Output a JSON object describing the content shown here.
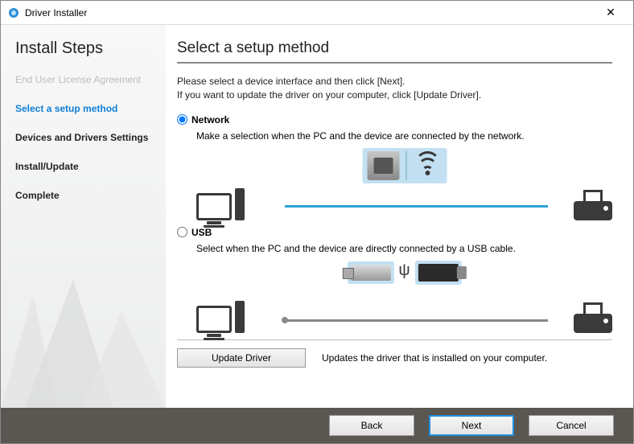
{
  "window": {
    "title": "Driver Installer"
  },
  "sidebar": {
    "heading": "Install Steps",
    "steps": [
      {
        "label": "End User License Agreement"
      },
      {
        "label": "Select a setup method"
      },
      {
        "label": "Devices and Drivers Settings"
      },
      {
        "label": "Install/Update"
      },
      {
        "label": "Complete"
      }
    ]
  },
  "content": {
    "heading": "Select a setup method",
    "intro1": "Please select a device interface and then click [Next].",
    "intro2": "If you want to update the driver on your computer, click [Update Driver].",
    "network": {
      "label": "Network",
      "desc": "Make a selection when the PC and the device are connected by the network."
    },
    "usb": {
      "label": "USB",
      "desc": "Select when the PC and the device are directly connected by a USB cable."
    },
    "update": {
      "button": "Update Driver",
      "desc": "Updates the driver that is installed on your computer."
    }
  },
  "footer": {
    "back": "Back",
    "next": "Next",
    "cancel": "Cancel"
  }
}
